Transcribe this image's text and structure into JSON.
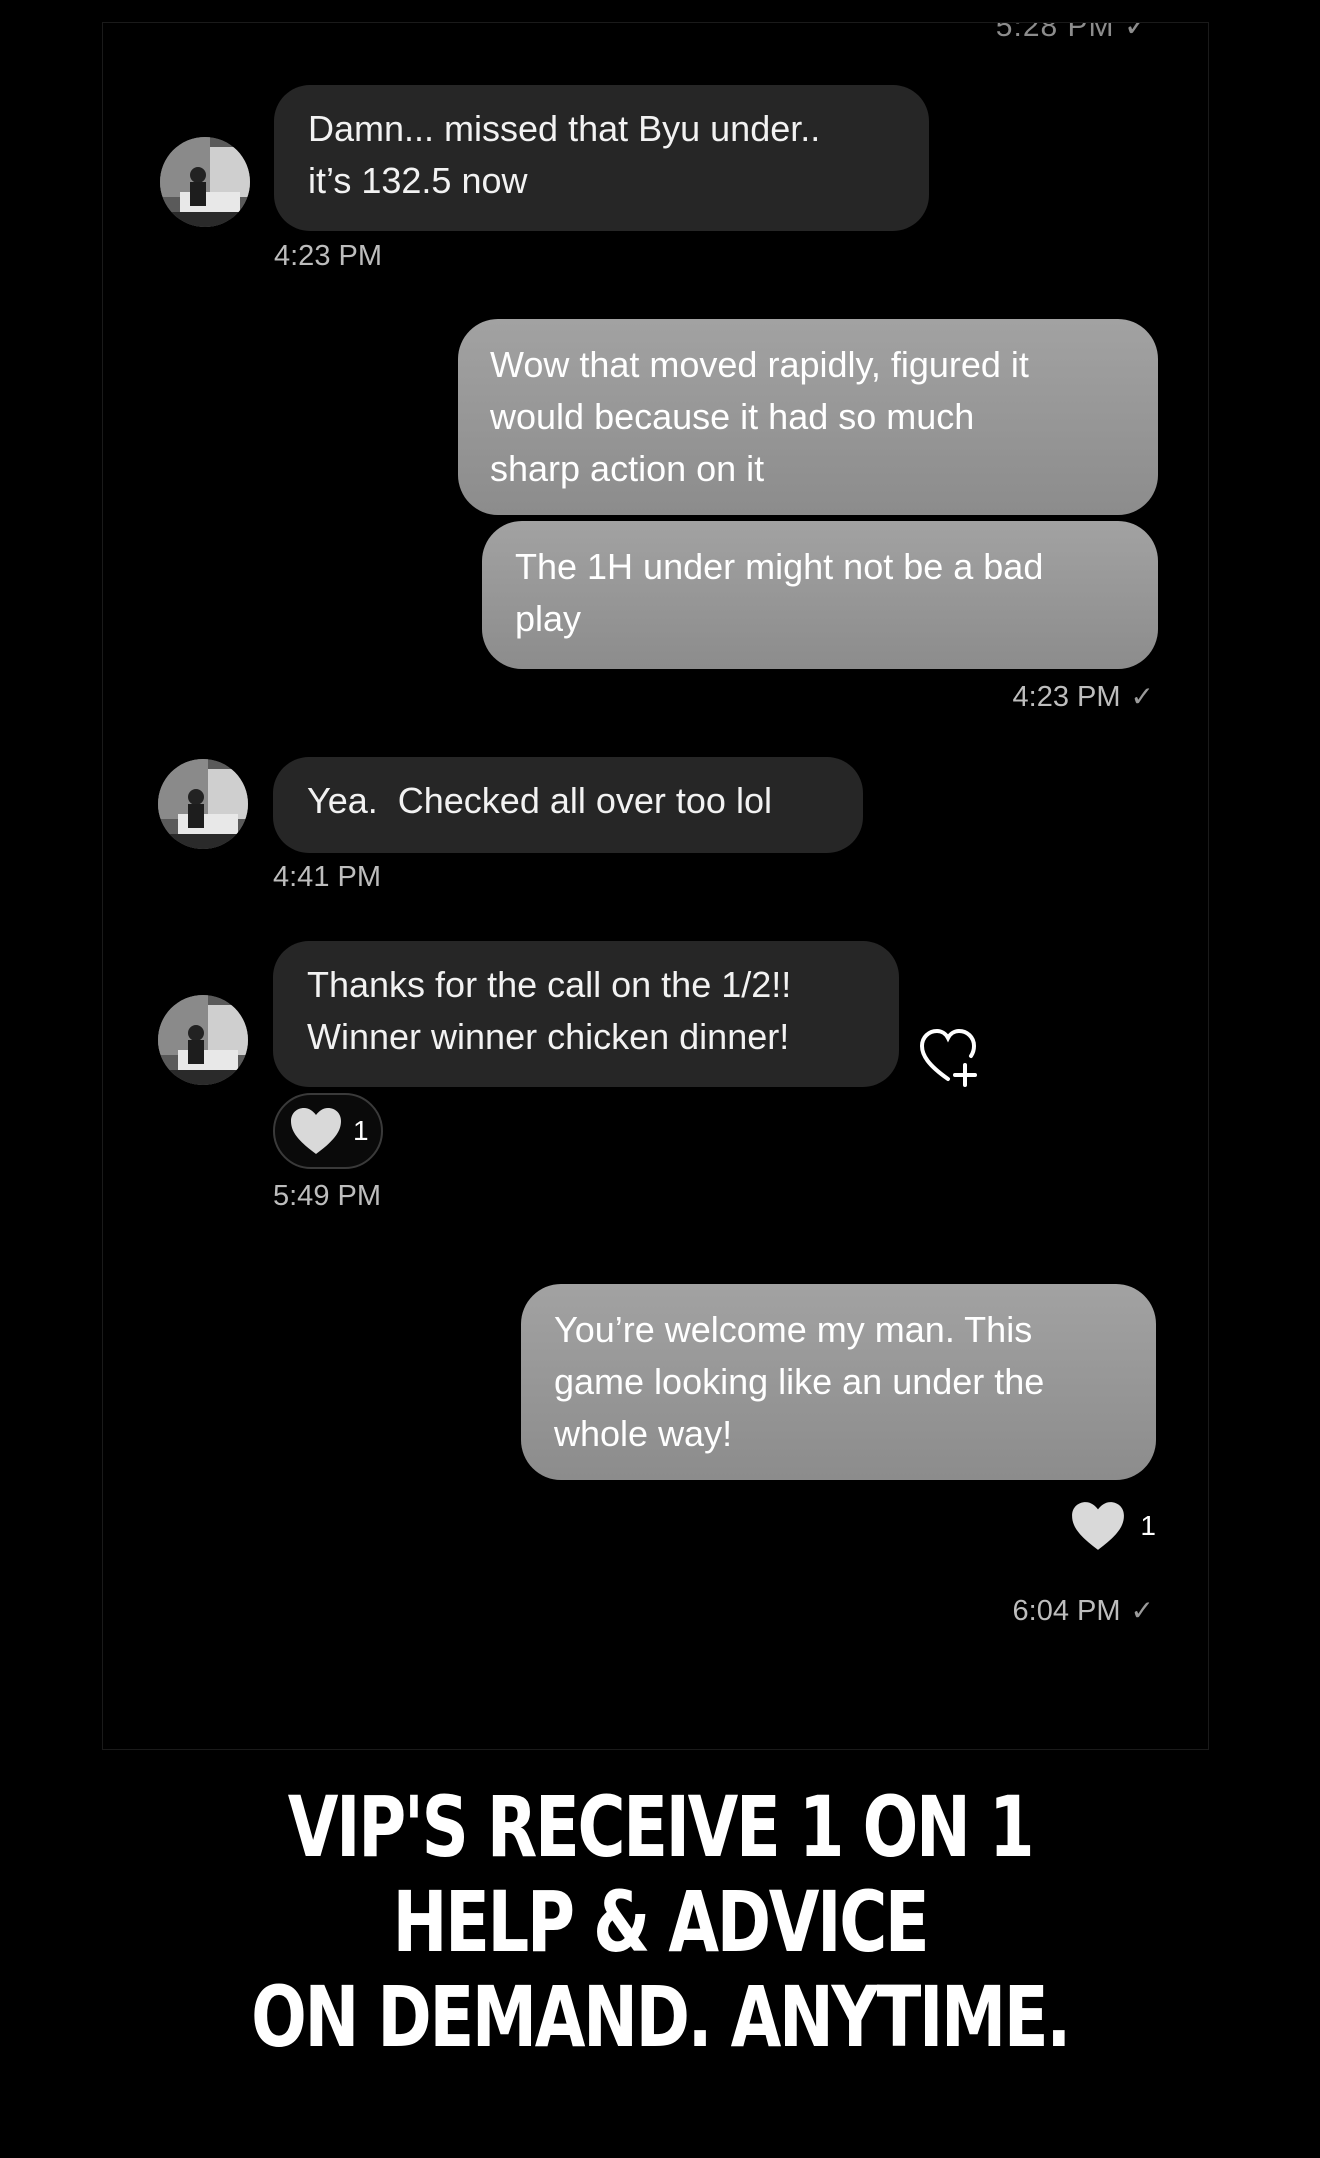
{
  "conversation": {
    "cut_timestamp": "5:28 PM ✓",
    "messages": [
      {
        "id": "m1",
        "direction": "incoming",
        "text": "Damn... missed that Byu under..\nit’s 132.5 now",
        "time": "4:23 PM"
      },
      {
        "id": "m2",
        "direction": "outgoing",
        "text": "Wow that moved rapidly, figured it\nwould because it had so much\nsharp action on it"
      },
      {
        "id": "m3",
        "direction": "outgoing",
        "text": "The 1H under might not be a bad\nplay",
        "time": "4:23 PM",
        "status": "✓"
      },
      {
        "id": "m4",
        "direction": "incoming",
        "text": "Yea.  Checked all over too lol",
        "time": "4:41 PM"
      },
      {
        "id": "m5",
        "direction": "incoming",
        "text": "Thanks for the call on the 1/2!!\nWinner winner chicken dinner!",
        "reaction_count": "1",
        "time": "5:49 PM"
      },
      {
        "id": "m6",
        "direction": "outgoing",
        "text": "You’re welcome my man. This\ngame looking like an under the\nwhole way!",
        "reaction_count": "1",
        "time": "6:04 PM",
        "status": "✓"
      }
    ]
  },
  "banner": {
    "line1": "VIP'S RECEIVE 1 ON 1",
    "line2": "HELP & ADVICE",
    "line3": "ON DEMAND. ANYTIME."
  },
  "icons": {
    "heart": "heart-icon",
    "add_reaction": "heart-plus-icon",
    "read_receipt": "checkmark-icon"
  },
  "colors": {
    "background": "#000000",
    "incoming_bubble": "#262626",
    "outgoing_bubble": "#959595",
    "timestamp": "#bdbdbd"
  }
}
